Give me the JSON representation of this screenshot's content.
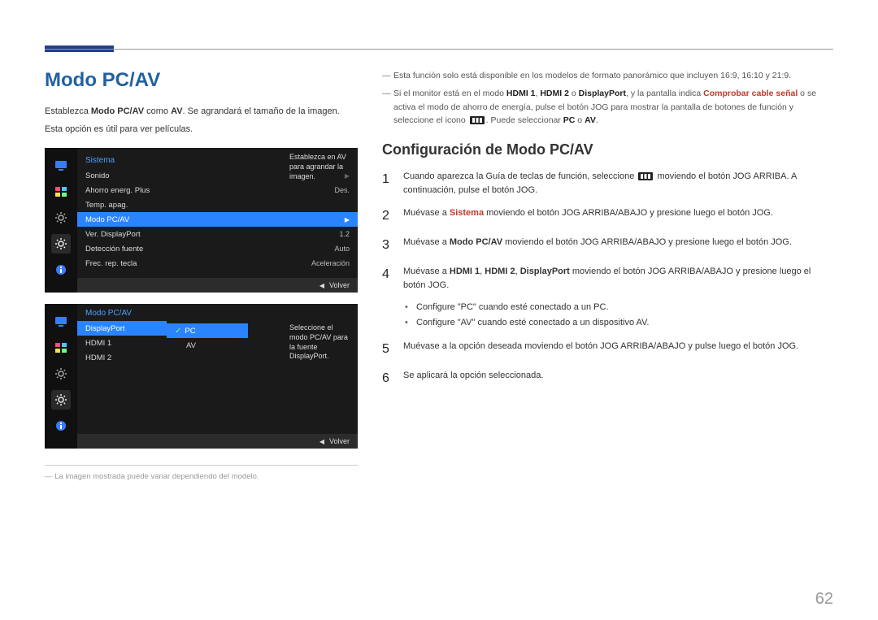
{
  "header": {
    "title": "Modo PC/AV"
  },
  "intro": {
    "line1_pre": "Establezca ",
    "line1_b1": "Modo PC/AV",
    "line1_mid": " como ",
    "line1_b2": "AV",
    "line1_post": ". Se agrandará el tamaño de la imagen.",
    "line2": "Esta opción es útil para ver películas."
  },
  "osd1": {
    "title": "Sistema",
    "help": "Establezca en AV para agrandar la imagen.",
    "rows": [
      {
        "label": "Sonido",
        "value": "",
        "chev": true
      },
      {
        "label": "Ahorro energ. Plus",
        "value": "Des."
      },
      {
        "label": "Temp. apag.",
        "value": ""
      },
      {
        "label": "Modo PC/AV",
        "value": "",
        "sel": true,
        "chev": true
      },
      {
        "label": "Ver. DisplayPort",
        "value": "1.2"
      },
      {
        "label": "Detección fuente",
        "value": "Auto"
      },
      {
        "label": "Frec. rep. tecla",
        "value": "Aceleración"
      }
    ],
    "footer": "Volver"
  },
  "osd2": {
    "title": "Modo PC/AV",
    "help": "Seleccione el modo PC/AV para la fuente DisplayPort.",
    "sources": [
      {
        "label": "DisplayPort",
        "sel": true
      },
      {
        "label": "HDMI 1"
      },
      {
        "label": "HDMI 2"
      }
    ],
    "modes": [
      {
        "label": "PC",
        "sel": true
      },
      {
        "label": "AV"
      }
    ],
    "footer": "Volver"
  },
  "foot_note": "La imagen mostrada puede variar dependiendo del modelo.",
  "right": {
    "note1": "Esta función solo está disponible en los modelos de formato panorámico que incluyen 16:9, 16:10 y 21:9.",
    "note2_pre": "Si el monitor está en el modo ",
    "note2_b1": "HDMI 1",
    "note2_sep1": ", ",
    "note2_b2": "HDMI 2",
    "note2_mid1": " o ",
    "note2_b3": "DisplayPort",
    "note2_mid2": ", y la pantalla indica ",
    "note2_red": "Comprobar cable señal",
    "note2_post1": " o se activa el modo de ahorro de energía, pulse el botón JOG para mostrar la pantalla de botones de función y seleccione el icono ",
    "note2_post2": ". Puede seleccionar ",
    "note2_b4": "PC",
    "note2_mid3": " o ",
    "note2_b5": "AV",
    "note2_end": ".",
    "h2": "Configuración de Modo PC/AV",
    "steps": [
      {
        "n": "1",
        "pre": "Cuando aparezca la Guía de teclas de función, seleccione ",
        "post": " moviendo el botón JOG ARRIBA. A continuación, pulse el botón JOG."
      },
      {
        "n": "2",
        "pre": "Muévase a ",
        "red": "Sistema",
        "post": " moviendo el botón JOG ARRIBA/ABAJO y presione luego el botón JOG."
      },
      {
        "n": "3",
        "pre": "Muévase a ",
        "b": "Modo PC/AV",
        "post": " moviendo el botón JOG ARRIBA/ABAJO y presione luego el botón JOG."
      },
      {
        "n": "4",
        "pre": "Muévase a ",
        "b1": "HDMI 1",
        "s1": ", ",
        "b2": "HDMI 2",
        "s2": ", ",
        "b3": "DisplayPort",
        "post": " moviendo el botón JOG ARRIBA/ABAJO y presione luego el botón JOG."
      },
      {
        "n": "5",
        "txt": "Muévase a la opción deseada moviendo el botón JOG ARRIBA/ABAJO y pulse luego el botón JOG."
      },
      {
        "n": "6",
        "txt": "Se aplicará la opción seleccionada."
      }
    ],
    "bullets": [
      "Configure \"PC\" cuando esté conectado a un PC.",
      "Configure \"AV\" cuando esté conectado a un dispositivo AV."
    ]
  },
  "page_number": "62"
}
